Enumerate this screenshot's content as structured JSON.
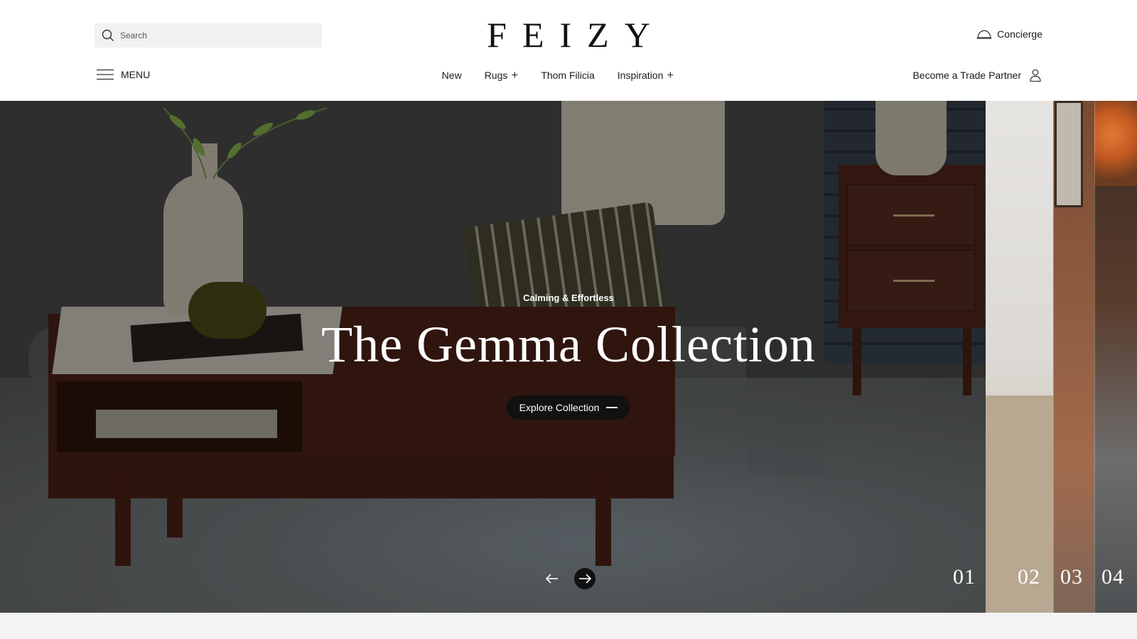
{
  "header": {
    "search_placeholder": "Search",
    "logo": "FEIZY",
    "concierge_label": "Concierge",
    "menu_label": "MENU",
    "trade_label": "Become a Trade Partner"
  },
  "nav": {
    "items": [
      {
        "label": "New",
        "expandable": false
      },
      {
        "label": "Rugs",
        "expandable": true
      },
      {
        "label": "Thom Filicia",
        "expandable": false
      },
      {
        "label": "Inspiration",
        "expandable": true
      }
    ],
    "plus_glyph": "+"
  },
  "hero": {
    "eyebrow": "Calming & Effortless",
    "title": "The Gemma Collection",
    "cta_label": "Explore Collection",
    "slides": [
      "01",
      "02",
      "03",
      "04"
    ],
    "active_slide": "01"
  },
  "icons": {
    "search": "search-icon",
    "concierge": "concierge-bell-icon",
    "menu": "hamburger-menu-icon",
    "user": "user-icon",
    "prev": "arrow-left-icon",
    "next": "arrow-right-icon"
  },
  "colors": {
    "header_bg": "#ffffff",
    "text": "#1a1a1a",
    "cta_bg": "#111111",
    "hero_text": "#ffffff",
    "page_bg": "#f3f3f3"
  }
}
